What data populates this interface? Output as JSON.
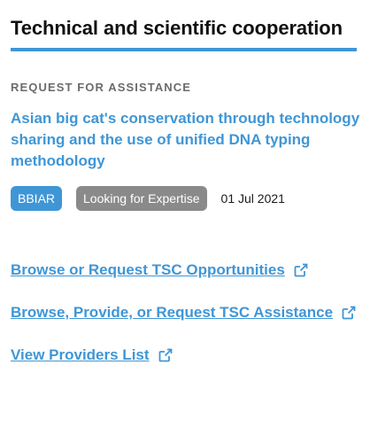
{
  "section": {
    "title": "Technical and scientific cooperation"
  },
  "card": {
    "type_label": "REQUEST FOR ASSISTANCE",
    "title": "Asian big cat's conservation through technology sharing and the use of unified DNA typing methodology",
    "tag": "BBIAR",
    "status": "Looking for Expertise",
    "date": "01 Jul 2021"
  },
  "links": [
    {
      "label": "Browse or Request TSC Opportunities",
      "icon": "external-link-icon"
    },
    {
      "label": "Browse, Provide, or Request TSC Assistance",
      "icon": "external-link-icon"
    },
    {
      "label": "View Providers List",
      "icon": "external-link-icon"
    }
  ],
  "colors": {
    "accent": "#3f96d6",
    "status_badge": "#8a8a8a",
    "muted_text": "#6b6b6b"
  }
}
